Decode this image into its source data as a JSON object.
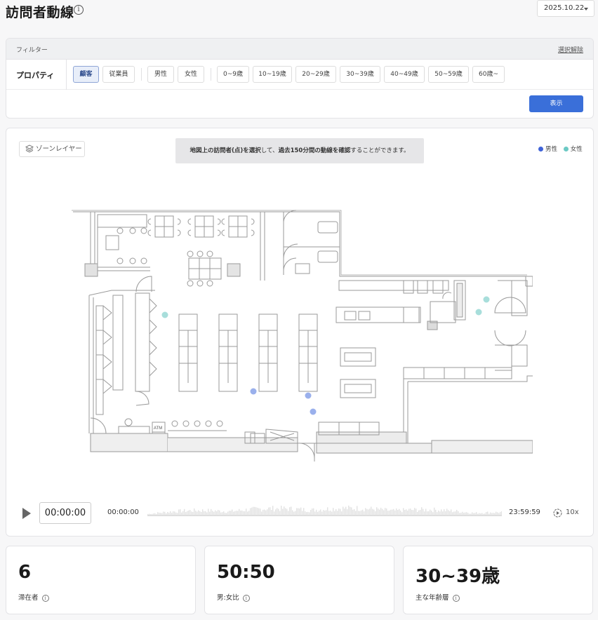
{
  "header": {
    "title": "訪問者動線",
    "info_glyph": "i",
    "date": "2025.10.22"
  },
  "filter": {
    "title": "フィルター",
    "clear_label": "選択解除",
    "property_label": "プロパティ",
    "chips": [
      "顧客",
      "従業員",
      "男性",
      "女性",
      "0~9歳",
      "10~19歳",
      "20~29歳",
      "30~39歳",
      "40~49歳",
      "50~59歳",
      "60歳~"
    ],
    "active_chip": "顧客",
    "show_button": "表示"
  },
  "map": {
    "zone_layer_label": "ゾーンレイヤー",
    "notice": {
      "part1": "地図上の訪問者(点)を選択",
      "part2": "して、",
      "part3": "過去150分間の動線を確認",
      "part4": "することができます。"
    },
    "legend": [
      {
        "label": "男性",
        "color": "#3f63d8"
      },
      {
        "label": "女性",
        "color": "#6cc9c4"
      }
    ],
    "atm_label": "ATM",
    "visitors": [
      {
        "gender": "female",
        "color": "#a8dedb"
      },
      {
        "gender": "female",
        "color": "#a8dedb"
      },
      {
        "gender": "female",
        "color": "#a8dedb"
      },
      {
        "gender": "male",
        "color": "#9ab0ec"
      },
      {
        "gender": "male",
        "color": "#9ab0ec"
      },
      {
        "gender": "male",
        "color": "#9ab0ec"
      }
    ]
  },
  "player": {
    "current_time": "00:00:00",
    "start_time": "00:00:00",
    "end_time": "23:59:59",
    "speed": "10x"
  },
  "stats": [
    {
      "value": "6",
      "label": "滞在者"
    },
    {
      "value": "50:50",
      "label": "男:女比"
    },
    {
      "value": "30~39歳",
      "label": "主な年齢層"
    }
  ]
}
